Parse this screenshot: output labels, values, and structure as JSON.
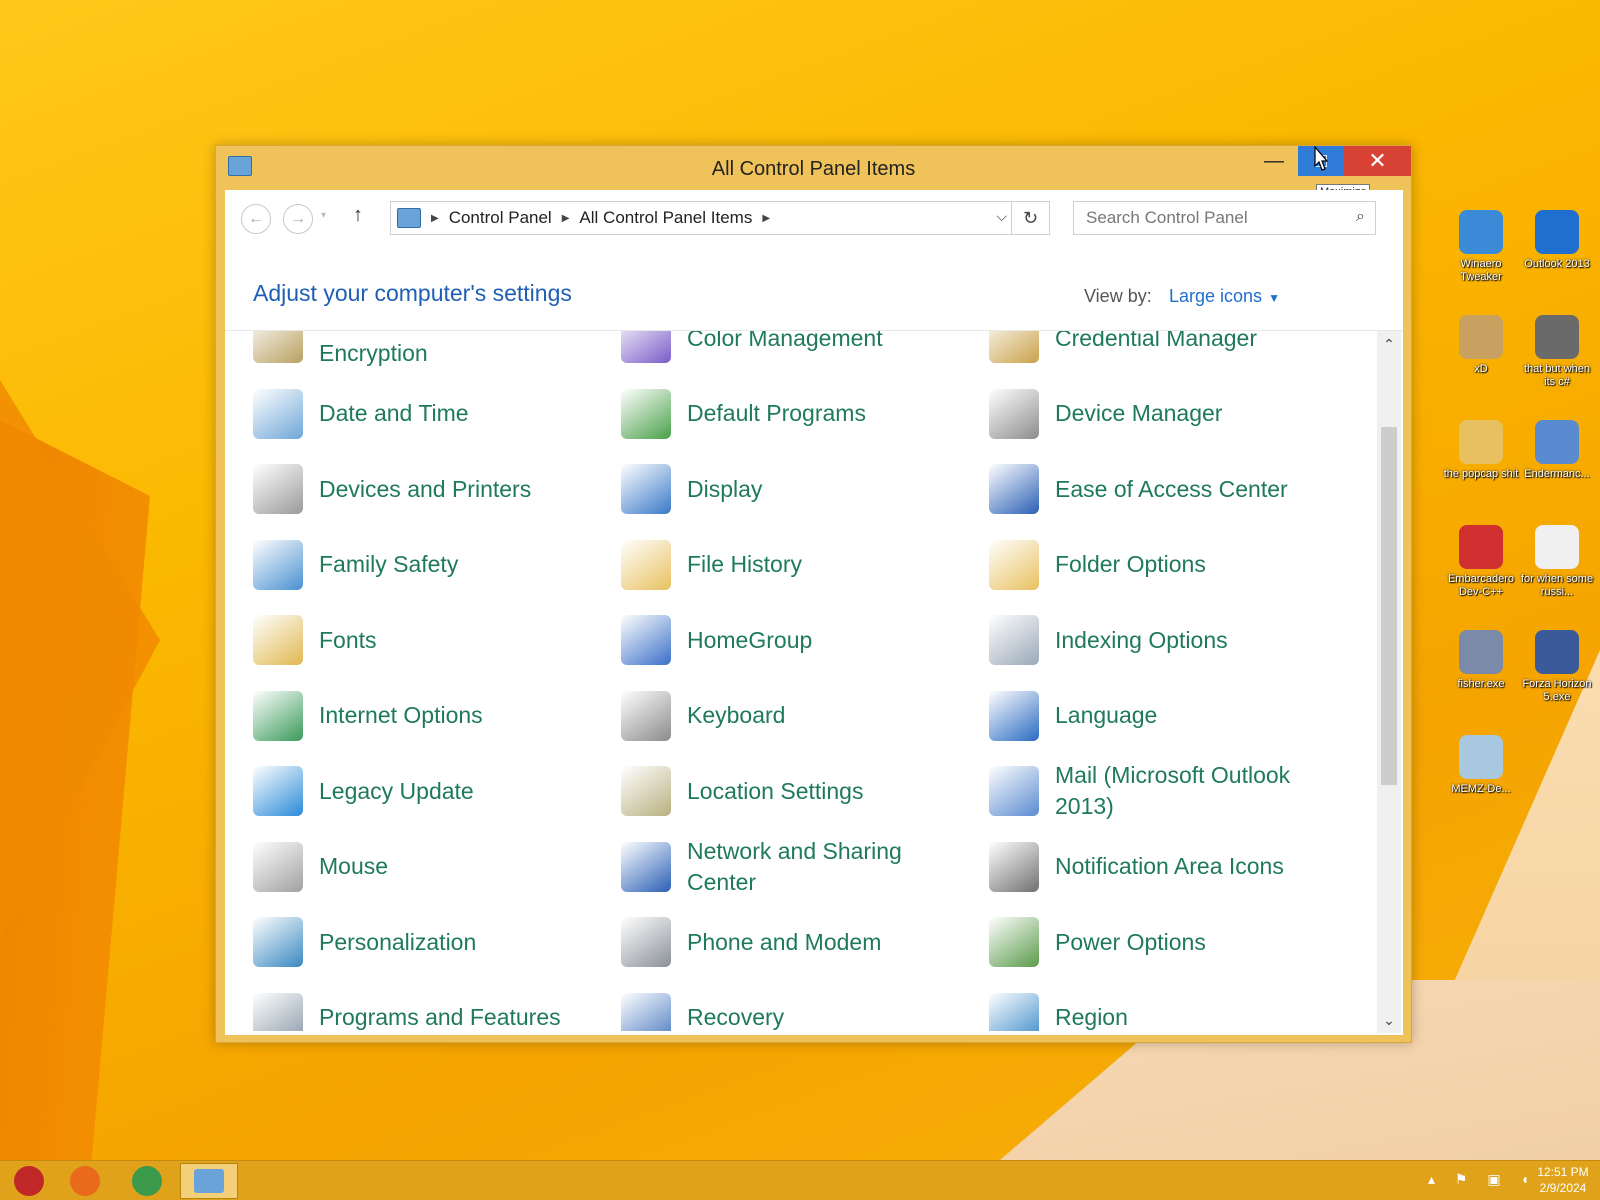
{
  "window": {
    "title": "All Control Panel Items",
    "minimize_glyph": "—",
    "maximize_glyph": "□",
    "close_glyph": "✕",
    "tooltip": "Maximize"
  },
  "nav": {
    "back_glyph": "←",
    "forward_glyph": "→",
    "recent_glyph": "▾",
    "up_glyph": "↑",
    "address": [
      "Control Panel",
      "All Control Panel Items"
    ],
    "refresh_glyph": "↻",
    "dropdown_glyph": "⌵",
    "search_placeholder": "Search Control Panel"
  },
  "content": {
    "heading": "Adjust your computer's settings",
    "view_by_label": "View by:",
    "view_by_value": "Large icons",
    "items": [
      {
        "label": "BitLocker Drive Encryption",
        "icon": "bitlocker-icon",
        "color": "#b8a060"
      },
      {
        "label": "Color Management",
        "icon": "color-management-icon",
        "color": "#7a5cc8"
      },
      {
        "label": "Credential Manager",
        "icon": "credential-manager-icon",
        "color": "#c9a24a"
      },
      {
        "label": "Date and Time",
        "icon": "date-time-icon",
        "color": "#6ea6d8"
      },
      {
        "label": "Default Programs",
        "icon": "default-programs-icon",
        "color": "#4aa04a"
      },
      {
        "label": "Device Manager",
        "icon": "device-manager-icon",
        "color": "#8c8c8c"
      },
      {
        "label": "Devices and Printers",
        "icon": "printer-icon",
        "color": "#9a9a9a"
      },
      {
        "label": "Display",
        "icon": "display-icon",
        "color": "#3a78c8"
      },
      {
        "label": "Ease of Access Center",
        "icon": "ease-of-access-icon",
        "color": "#2a5fb5"
      },
      {
        "label": "Family Safety",
        "icon": "family-safety-icon",
        "color": "#4a90d0"
      },
      {
        "label": "File History",
        "icon": "file-history-icon",
        "color": "#e8c060"
      },
      {
        "label": "Folder Options",
        "icon": "folder-options-icon",
        "color": "#e8c060"
      },
      {
        "label": "Fonts",
        "icon": "fonts-icon",
        "color": "#e0b850"
      },
      {
        "label": "HomeGroup",
        "icon": "homegroup-icon",
        "color": "#3a6fc8"
      },
      {
        "label": "Indexing Options",
        "icon": "indexing-options-icon",
        "color": "#9aa8b8"
      },
      {
        "label": "Internet Options",
        "icon": "internet-options-icon",
        "color": "#3a9a5a"
      },
      {
        "label": "Keyboard",
        "icon": "keyboard-icon",
        "color": "#8a8a8a"
      },
      {
        "label": "Language",
        "icon": "language-icon",
        "color": "#2a6ac0"
      },
      {
        "label": "Legacy Update",
        "icon": "legacy-update-icon",
        "color": "#2a8ad8"
      },
      {
        "label": "Location Settings",
        "icon": "location-settings-icon",
        "color": "#b8b080"
      },
      {
        "label": "Mail (Microsoft Outlook 2013)",
        "icon": "mail-icon",
        "color": "#5a8ad0"
      },
      {
        "label": "Mouse",
        "icon": "mouse-icon",
        "color": "#a0a0a0"
      },
      {
        "label": "Network and Sharing Center",
        "icon": "network-sharing-icon",
        "color": "#2a5fb5"
      },
      {
        "label": "Notification Area Icons",
        "icon": "notification-area-icon",
        "color": "#707070"
      },
      {
        "label": "Personalization",
        "icon": "personalization-icon",
        "color": "#3a88c0"
      },
      {
        "label": "Phone and Modem",
        "icon": "phone-modem-icon",
        "color": "#8a9098"
      },
      {
        "label": "Power Options",
        "icon": "power-options-icon",
        "color": "#5a9a4a"
      },
      {
        "label": "Programs and Features",
        "icon": "programs-features-icon",
        "color": "#8a9aa8"
      },
      {
        "label": "Recovery",
        "icon": "recovery-icon",
        "color": "#4a7ac0"
      },
      {
        "label": "Region",
        "icon": "region-icon",
        "color": "#3a88c8"
      }
    ]
  },
  "desktop_icons": [
    {
      "label": "Winaero Tweaker",
      "icon": "winaero-icon",
      "color": "#3a8ad8"
    },
    {
      "label": "Outlook 2013",
      "icon": "outlook-icon",
      "color": "#1e6fd0"
    },
    {
      "label": "xD",
      "icon": "hxd-icon",
      "color": "#c8a060"
    },
    {
      "label": "that but when its c#",
      "icon": "app-stack-icon",
      "color": "#6a6a6a"
    },
    {
      "label": "the popcap shit",
      "icon": "folder-icon",
      "color": "#e8c060"
    },
    {
      "label": "Endermanc...",
      "icon": "endermanch-icon",
      "color": "#5a8ad0"
    },
    {
      "label": "Embarcadero Dev-C++",
      "icon": "devcpp-icon",
      "color": "#d03030"
    },
    {
      "label": "for when some russi...",
      "icon": "de-icon",
      "color": "#f0f0f0"
    },
    {
      "label": "fisher.exe",
      "icon": "fish-icon",
      "color": "#7a8aa8"
    },
    {
      "label": "Forza Horizon 5.exe",
      "icon": "forza-icon",
      "color": "#3a5a9a"
    },
    {
      "label": "MEMZ-De...",
      "icon": "recycle-bin-icon",
      "color": "#a8c8e0"
    }
  ],
  "taskbar": {
    "apps": [
      {
        "name": "Start",
        "icon": "start-orb-icon",
        "color": "#c02828"
      },
      {
        "name": "Firefox",
        "icon": "firefox-icon",
        "color": "#e86a1a"
      },
      {
        "name": "Chrome",
        "icon": "chrome-icon",
        "color": "#3a9a4a"
      },
      {
        "name": "Control Panel",
        "icon": "control-panel-icon",
        "color": "#6aa3d8"
      }
    ],
    "tray_glyphs": "▴ ⚑ ▣ ◖",
    "time": "12:51 PM",
    "date": "2/9/2024"
  }
}
